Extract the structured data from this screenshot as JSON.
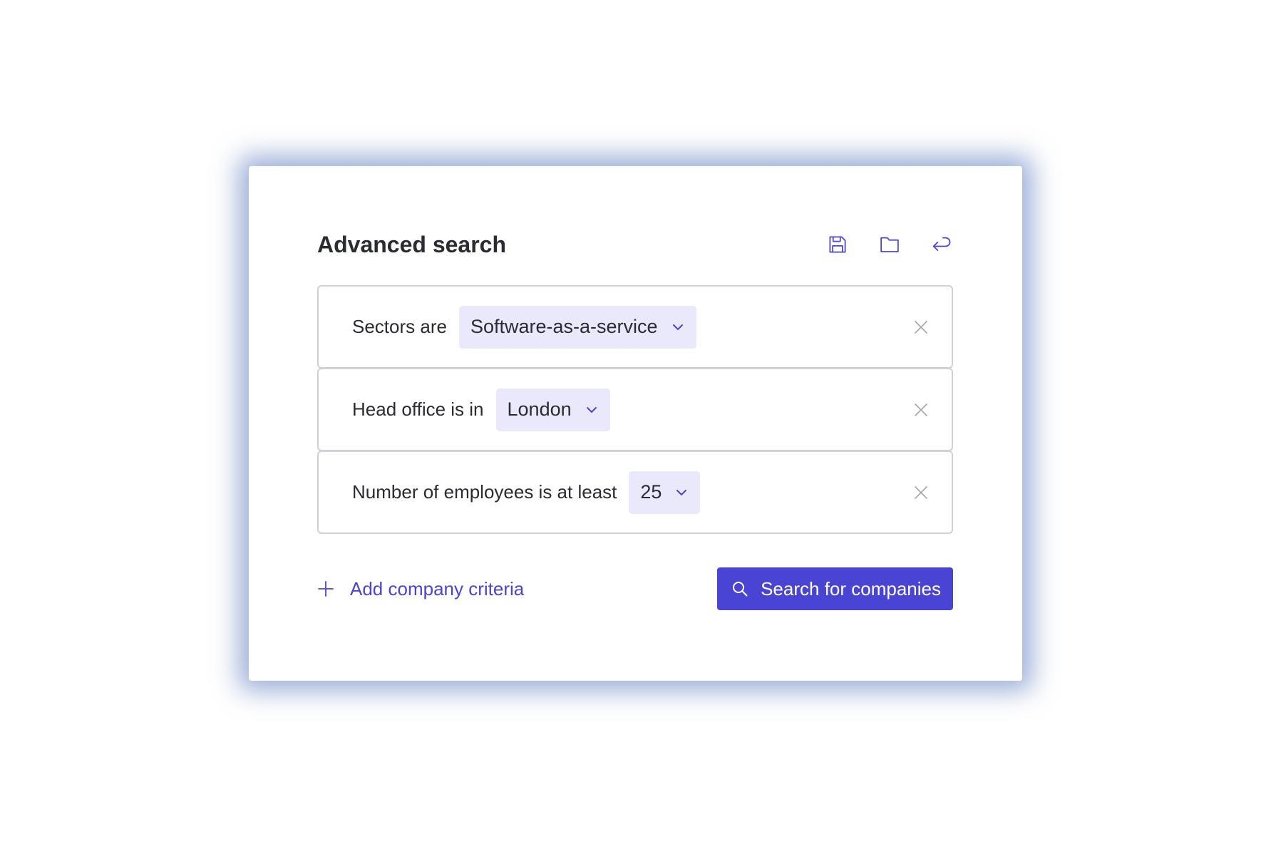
{
  "colors": {
    "accent": "#4a44d4",
    "chip_bg": "#e9e9fb",
    "text": "#2a2b33",
    "border": "#d0d0d7",
    "shadow": "#486cb6"
  },
  "panel": {
    "title": "Advanced search",
    "actions": [
      {
        "icon": "save-icon"
      },
      {
        "icon": "folder-icon"
      },
      {
        "icon": "return-icon"
      }
    ]
  },
  "criteria": [
    {
      "label": "Sectors are",
      "value": "Software-as-a-service"
    },
    {
      "label": "Head office is in",
      "value": "London"
    },
    {
      "label": "Number of employees is at least",
      "value": "25"
    }
  ],
  "footer": {
    "add_label": "Add company criteria",
    "search_label": "Search for companies"
  }
}
